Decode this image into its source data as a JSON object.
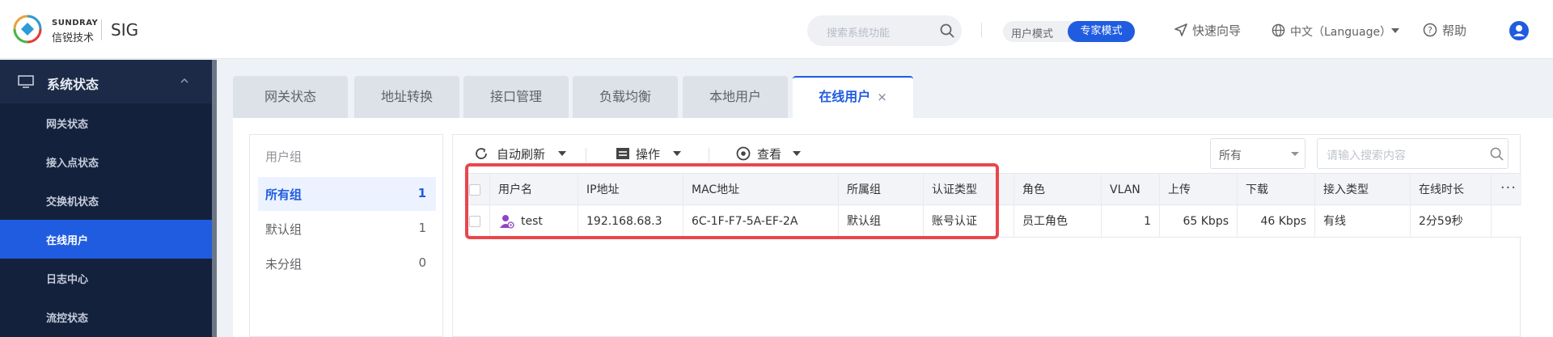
{
  "brand": {
    "name_en": "SUNDRAY",
    "name_cn": "信锐技术",
    "product": "SIG"
  },
  "header": {
    "search_placeholder": "搜索系统功能",
    "mode_user": "用户模式",
    "mode_expert": "专家模式",
    "wizard": "快速向导",
    "language": "中文（Language）",
    "help": "帮助"
  },
  "sidebar": {
    "section": "系统状态",
    "items": [
      {
        "label": "网关状态"
      },
      {
        "label": "接入点状态"
      },
      {
        "label": "交换机状态"
      },
      {
        "label": "在线用户"
      },
      {
        "label": "日志中心"
      },
      {
        "label": "流控状态"
      }
    ]
  },
  "tabs": [
    {
      "label": "网关状态"
    },
    {
      "label": "地址转换"
    },
    {
      "label": "接口管理"
    },
    {
      "label": "负载均衡"
    },
    {
      "label": "本地用户"
    },
    {
      "label": "在线用户",
      "close": "×"
    }
  ],
  "groups": {
    "title": "用户组",
    "items": [
      {
        "name": "所有组",
        "count": "1"
      },
      {
        "name": "默认组",
        "count": "1"
      },
      {
        "name": "未分组",
        "count": "0"
      }
    ]
  },
  "toolbar": {
    "refresh": "自动刷新",
    "operate": "操作",
    "view": "查看",
    "filter": "所有",
    "search_placeholder": "请输入搜索内容"
  },
  "table": {
    "columns": [
      "用户名",
      "IP地址",
      "MAC地址",
      "所属组",
      "认证类型",
      "角色",
      "VLAN",
      "上传",
      "下载",
      "接入类型",
      "在线时长"
    ],
    "more": "···",
    "rows": [
      [
        "test",
        "192.168.68.3",
        "6C-1F-F7-5A-EF-2A",
        "默认组",
        "账号认证",
        "员工角色",
        "1",
        "65 Kbps",
        "46 Kbps",
        "有线",
        "2分59秒"
      ]
    ]
  },
  "colors": {
    "accent": "#1f5ce0",
    "sidebar_bg": "#13213d",
    "highlight": "#e8474c"
  }
}
